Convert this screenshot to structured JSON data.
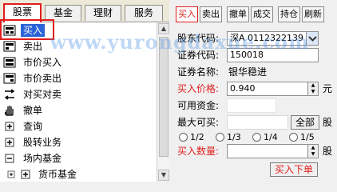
{
  "tabs": [
    {
      "label": "股票",
      "active": true
    },
    {
      "label": "基金",
      "active": false
    },
    {
      "label": "理财",
      "active": false
    },
    {
      "label": "服务",
      "active": false
    }
  ],
  "tree": [
    {
      "label": "买入",
      "icon": "buy-icon",
      "selected": true
    },
    {
      "label": "卖出",
      "icon": "sell-icon"
    },
    {
      "label": "市价买入",
      "icon": "market-buy-icon"
    },
    {
      "label": "市价卖出",
      "icon": "market-sell-icon"
    },
    {
      "label": "对买对卖",
      "icon": "swap-icon"
    },
    {
      "label": "撤单",
      "icon": "hand-icon"
    },
    {
      "label": "查询",
      "icon": "expand-icon"
    },
    {
      "label": "股转业务",
      "icon": "expand-icon"
    },
    {
      "label": "场内基金",
      "icon": "collapse-icon"
    },
    {
      "label": "货币基金",
      "icon": "expand-icon"
    }
  ],
  "toolbar": [
    "买入",
    "卖出",
    "撤单",
    "成交",
    "持仓",
    "刷新"
  ],
  "form": {
    "account_label": "股东代码:",
    "account_value": "深A 0112322139",
    "code_label": "证券代码:",
    "code_value": "150018",
    "name_label": "证券名称:",
    "name_value": "银华稳进",
    "price_label": "买入价格:",
    "price_value": "0.940",
    "price_unit": "元",
    "funds_label": "可用资金:",
    "max_label": "最大可买:",
    "all_button": "全部",
    "shares_unit": "股",
    "ratio_options": [
      "1/2",
      "1/3",
      "1/4",
      "1/5"
    ],
    "qty_label": "买入数量:",
    "qty_unit": "股",
    "submit_button": "买入下单"
  },
  "watermark": "www.yurongdaxue.com",
  "colors": {
    "accent": "#e11d1d",
    "selection": "#2a63d6"
  }
}
